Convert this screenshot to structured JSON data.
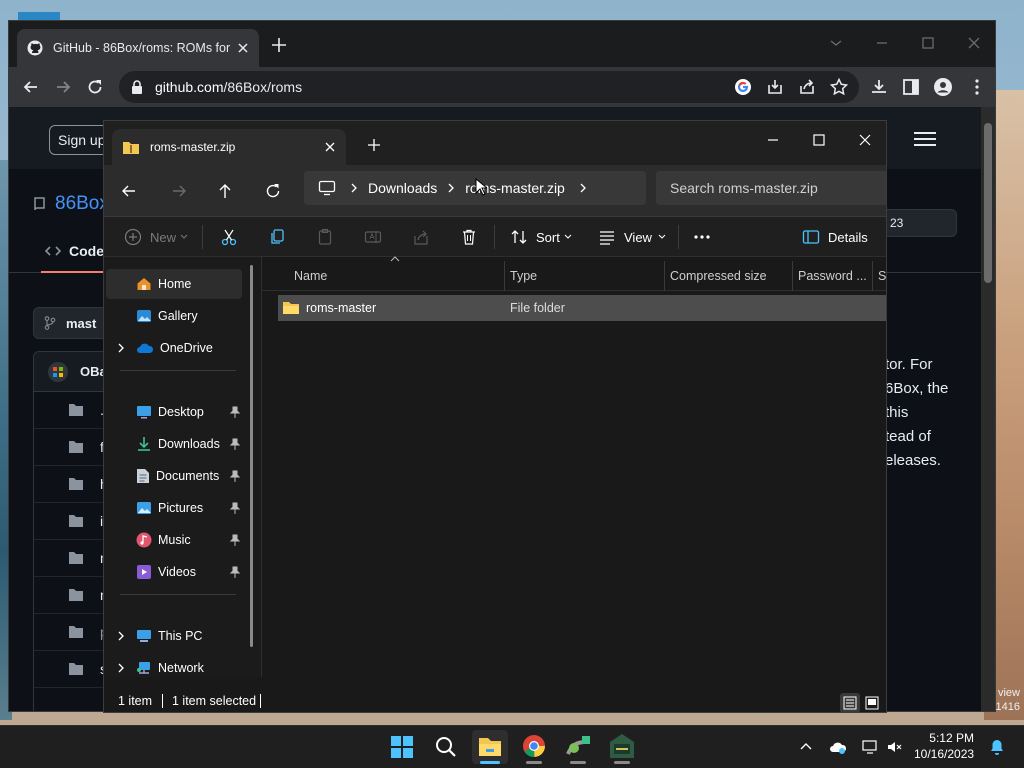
{
  "browser": {
    "tab_title": "GitHub - 86Box/roms: ROMs for",
    "url_domain": "github.com",
    "url_path": "/86Box/roms"
  },
  "github": {
    "signup_label": "Sign up",
    "repo_name": "86Box",
    "code_tab": "Code",
    "branch": "mast",
    "commit_author": "OBa",
    "star_count": "23",
    "files": [
      ".git",
      "flop",
      "hdd",
      "icon",
      "mac",
      "netw",
      "prin",
      "scsi"
    ],
    "readme_lines": [
      "tor. For",
      "6Box, the",
      "this",
      "tead of",
      "eleases."
    ]
  },
  "explorer": {
    "tab_title": "roms-master.zip",
    "breadcrumbs": [
      "Downloads",
      "roms-master.zip"
    ],
    "search_placeholder": "Search roms-master.zip",
    "commands": {
      "new": "New",
      "sort": "Sort",
      "view": "View",
      "details": "Details"
    },
    "nav": {
      "home": "Home",
      "gallery": "Gallery",
      "onedrive": "OneDrive",
      "desktop": "Desktop",
      "downloads": "Downloads",
      "documents": "Documents",
      "pictures": "Pictures",
      "music": "Music",
      "videos": "Videos",
      "this_pc": "This PC",
      "network": "Network"
    },
    "columns": {
      "name": "Name",
      "type": "Type",
      "compressed": "Compressed size",
      "password": "Password ...",
      "size": "Si"
    },
    "rows": [
      {
        "name": "roms-master",
        "type": "File folder"
      }
    ],
    "status": {
      "count": "1 item",
      "selected": "1 item selected"
    }
  },
  "desktop": {
    "watermark_line1": "view",
    "watermark_line2": "1416"
  },
  "taskbar": {
    "time": "5:12 PM",
    "date": "10/16/2023"
  },
  "colors": {
    "accent": "#4cc2ff",
    "github_link": "#4493f8",
    "folder": "#f4c752"
  }
}
